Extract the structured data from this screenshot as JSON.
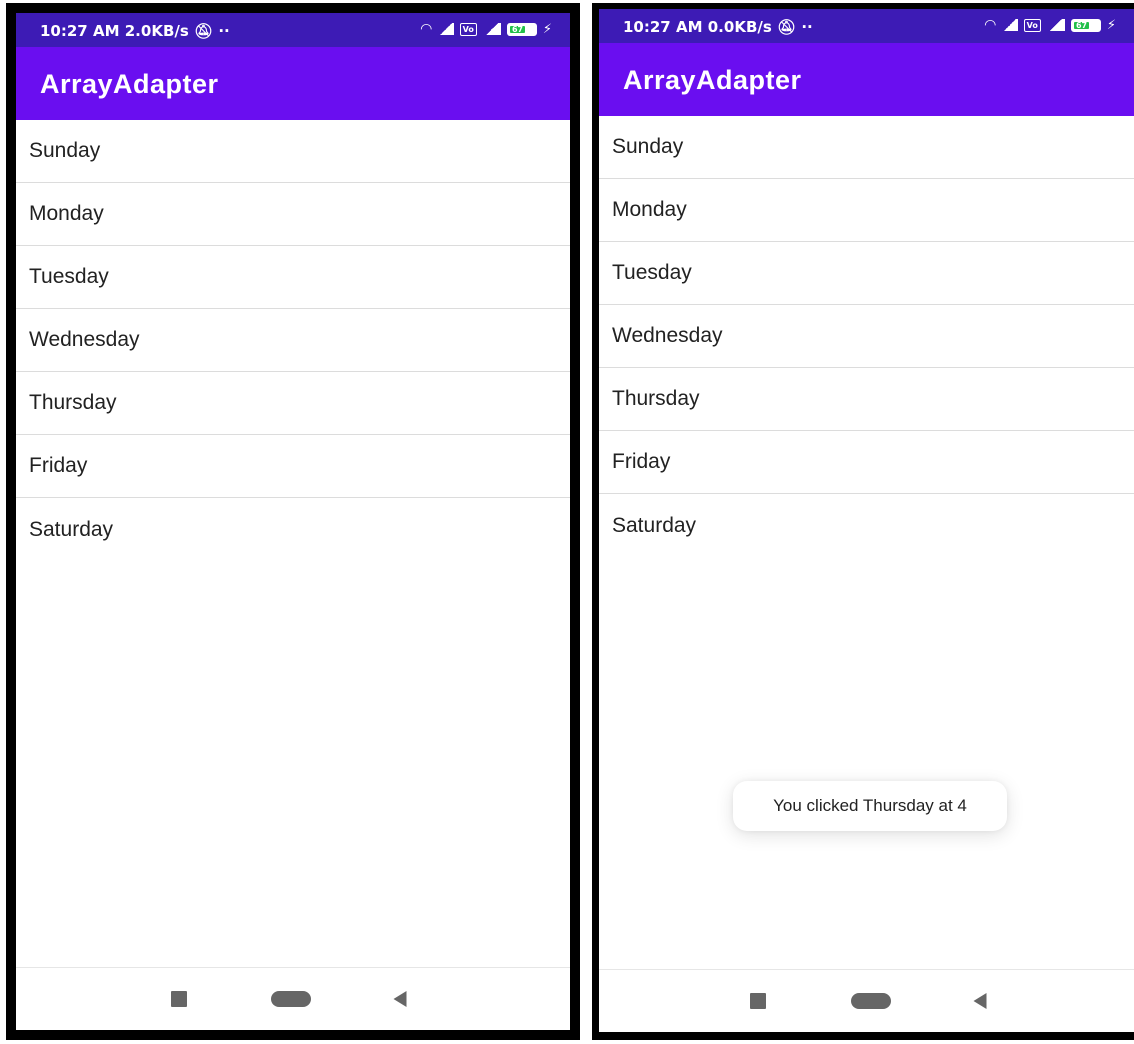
{
  "colors": {
    "status_bar": "#3d1bb5",
    "app_bar": "#6a0ef0",
    "battery_fill": "#22c04a",
    "divider": "#dcdcdc"
  },
  "screens": [
    {
      "status": {
        "time": "10:27 AM",
        "speed": "2.0KB/s",
        "icons": [
          "mute-icon",
          "dots-icon",
          "wifi-icon",
          "signal-icon",
          "volte-icon",
          "lte-signal-icon",
          "battery-icon",
          "charging-icon"
        ],
        "volte": "Vo",
        "battery_level": "67"
      },
      "app_title": "ArrayAdapter",
      "items": [
        "Sunday",
        "Monday",
        "Tuesday",
        "Wednesday",
        "Thursday",
        "Friday",
        "Saturday"
      ]
    },
    {
      "status": {
        "time": "10:27 AM",
        "speed": "0.0KB/s",
        "icons": [
          "mute-icon",
          "dots-icon",
          "wifi-icon",
          "signal-icon",
          "volte-icon",
          "lte-signal-icon",
          "battery-icon",
          "charging-icon"
        ],
        "volte": "Vo",
        "battery_level": "67"
      },
      "app_title": "ArrayAdapter",
      "items": [
        "Sunday",
        "Monday",
        "Tuesday",
        "Wednesday",
        "Thursday",
        "Friday",
        "Saturday"
      ],
      "toast": "You clicked Thursday at 4"
    }
  ]
}
